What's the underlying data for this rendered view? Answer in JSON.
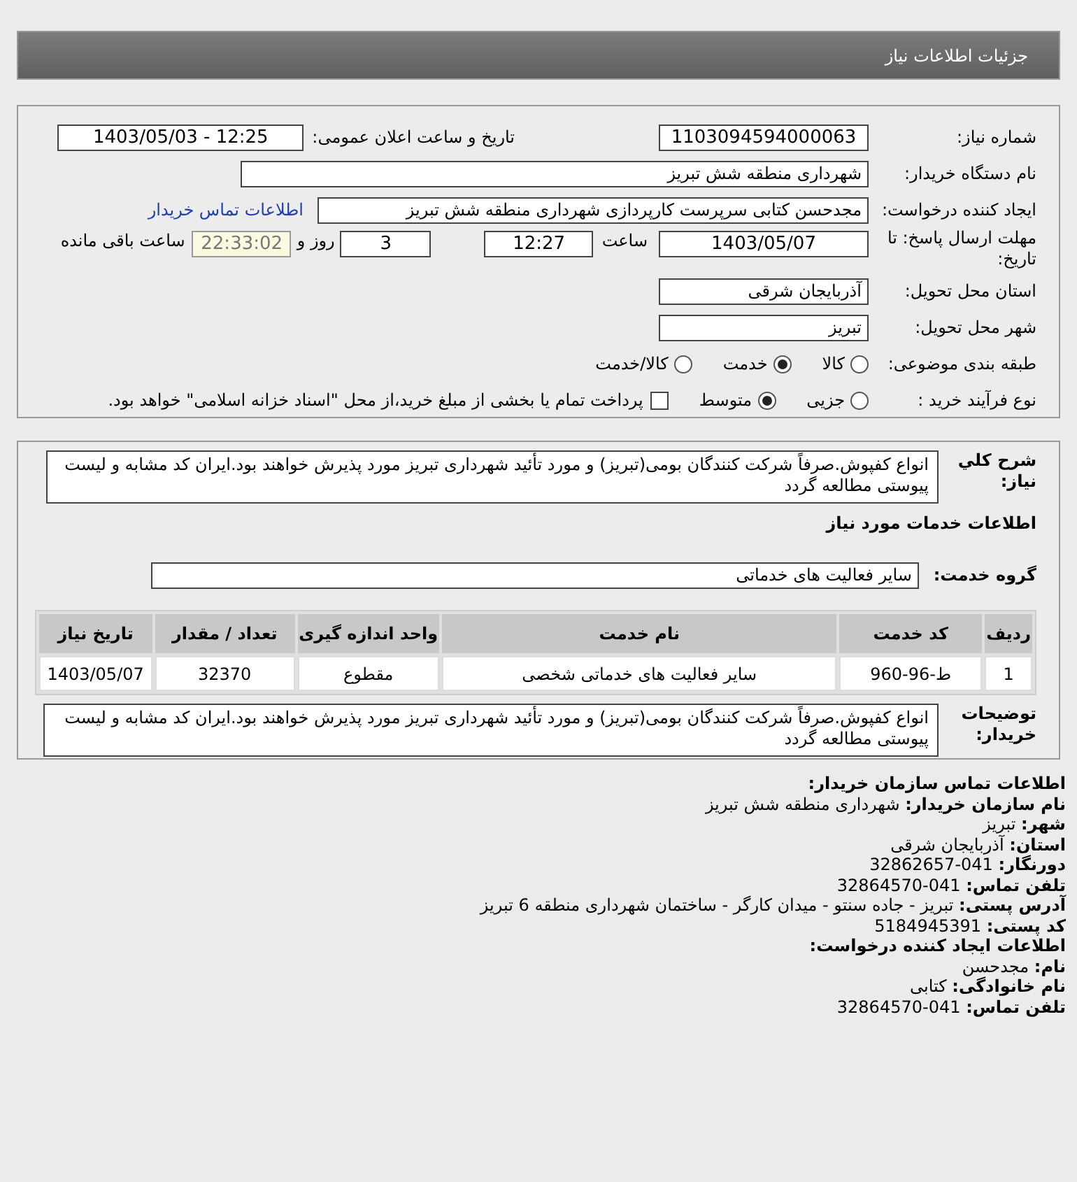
{
  "page_title": "جزئیات اطلاعات نیاز",
  "need_number": {
    "label": "شماره نیاز:",
    "value": "1103094594000063"
  },
  "announce_datetime": {
    "label": "تاریخ و ساعت اعلان عمومی:",
    "value": "1403/05/03 - 12:25"
  },
  "buyer_org": {
    "label": "نام دستگاه خریدار:",
    "value": "شهرداری منطقه شش تبریز"
  },
  "requester": {
    "label": "ایجاد کننده درخواست:",
    "value": "مجدحسن کتابی سرپرست کارپردازی شهرداری منطقه شش تبریز",
    "contact_link": "اطلاعات تماس خریدار"
  },
  "deadline": {
    "label": "مهلت ارسال پاسخ: تا تاریخ:",
    "date": "1403/05/07",
    "time_label": "ساعت",
    "time": "12:27",
    "days": "3",
    "days_label": "روز و",
    "remaining": "22:33:02",
    "remaining_label": "ساعت باقی مانده"
  },
  "delivery_province": {
    "label": "استان محل تحویل:",
    "value": "آذربایجان شرقی"
  },
  "delivery_city": {
    "label": "شهر محل تحویل:",
    "value": "تبریز"
  },
  "category": {
    "label": "طبقه بندی موضوعی:",
    "options": [
      {
        "label": "کالا",
        "selected": false
      },
      {
        "label": "خدمت",
        "selected": true
      },
      {
        "label": "کالا/خدمت",
        "selected": false
      }
    ]
  },
  "purchase_process": {
    "label": "نوع فرآیند خرید :",
    "options": [
      {
        "label": "جزیی",
        "selected": false
      },
      {
        "label": "متوسط",
        "selected": true
      }
    ],
    "payment_checkbox": {
      "label": "پرداخت تمام یا بخشی از مبلغ خرید،از محل \"اسناد خزانه اسلامی\" خواهد بود.",
      "checked": false
    }
  },
  "description": {
    "label": "شرح کلي نياز:",
    "text": "انواع کفپوش.صرفاً شرکت کنندگان بومی(تبریز) و مورد تأئید شهرداری تبریز مورد پذیرش خواهند بود.ایران کد مشابه و لیست پیوستی مطالعه گردد"
  },
  "services_heading": "اطلاعات خدمات مورد نیاز",
  "service_group": {
    "label": "گروه خدمت:",
    "value": "سایر فعالیت های خدماتی"
  },
  "table": {
    "columns": [
      "ردیف",
      "کد خدمت",
      "نام خدمت",
      "واحد اندازه گیری",
      "تعداد / مقدار",
      "تاریخ نیاز"
    ],
    "rows": [
      [
        "1",
        "ط-96-960",
        "سایر فعالیت های خدماتی شخصی",
        "مقطوع",
        "32370",
        "1403/05/07"
      ]
    ]
  },
  "buyer_notes": {
    "label": "توضیحات خریدار:",
    "text": "انواع کفپوش.صرفاً شرکت کنندگان بومی(تبریز) و مورد تأئید شهرداری تبریز مورد پذیرش خواهند بود.ایران کد مشابه و لیست پیوستی مطالعه گردد"
  },
  "contact": {
    "heading": "اطلاعات تماس سازمان خریدار:",
    "lines": [
      "**نام سازمان خریدار:** شهرداری منطقه شش تبریز",
      "**شهر:** تبریز",
      "**استان:** آذربایجان شرقی",
      "**دورنگار:** 041-32862657",
      "**تلفن تماس:** 041-32864570",
      "**آدرس پستی:** تبریز - جاده سنتو - میدان کارگر - ساختمان شهرداری منطقه 6 تبریز",
      "**کد پستی:** 5184945391"
    ],
    "creator_heading": "اطلاعات ایجاد کننده درخواست:",
    "creator_lines": [
      "**نام:** مجدحسن",
      "**نام خانوادگی:** کتابی",
      "**تلفن تماس:** 041-32864570"
    ]
  }
}
